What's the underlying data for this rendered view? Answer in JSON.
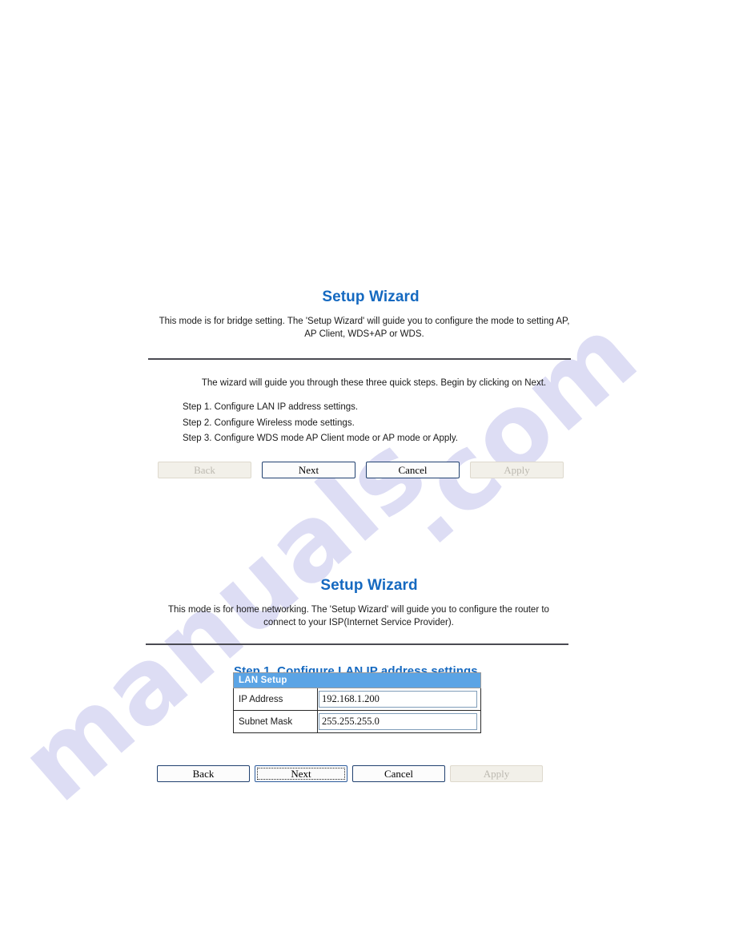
{
  "watermark": {
    "line_a": "manuals",
    "line_b": ".com"
  },
  "panels": [
    {
      "id": "bridge",
      "title": "Setup Wizard",
      "description": "This mode is for bridge setting. The 'Setup Wizard' will guide you to configure the mode to setting AP, AP Client, WDS+AP or WDS.",
      "intro": "The wizard will guide you through these three quick steps. Begin by clicking on Next.",
      "steps": [
        "Step 1. Configure LAN IP address settings.",
        "Step 2. Configure Wireless mode settings.",
        "Step 3. Configure WDS mode AP Client mode or AP mode or Apply."
      ],
      "buttons": [
        {
          "label": "Back",
          "state": "disabled"
        },
        {
          "label": "Next",
          "state": "outlined"
        },
        {
          "label": "Cancel",
          "state": "outlined"
        },
        {
          "label": "Apply",
          "state": "disabled"
        }
      ]
    },
    {
      "id": "home",
      "title": "Setup Wizard",
      "description": "This mode is for home networking. The 'Setup Wizard' will guide you to configure the router to connect to your ISP(Internet Service Provider).",
      "step_heading": "Step 1. Configure LAN IP address settings",
      "table": {
        "header": "LAN Setup",
        "rows": [
          {
            "label": "IP Address",
            "value": "192.168.1.200"
          },
          {
            "label": "Subnet Mask",
            "value": "255.255.255.0"
          }
        ]
      },
      "buttons": [
        {
          "label": "Back",
          "state": "enabled"
        },
        {
          "label": "Next",
          "state": "focused"
        },
        {
          "label": "Cancel",
          "state": "enabled"
        },
        {
          "label": "Apply",
          "state": "disabled"
        }
      ]
    }
  ],
  "colors": {
    "heading_blue": "#1569c0",
    "table_header_blue": "#5ba4e5",
    "button_border": "#2b5a9b",
    "disabled_fill": "#f2f0e9",
    "watermark": "#c9c9ee"
  }
}
